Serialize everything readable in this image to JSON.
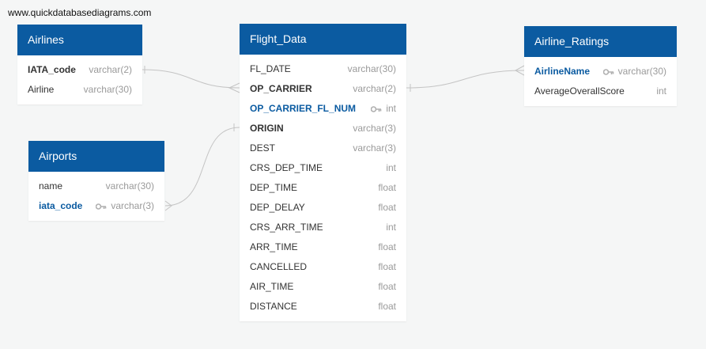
{
  "watermark": "www.quickdatabasediagrams.com",
  "tables": {
    "airlines": {
      "title": "Airlines",
      "fields": [
        {
          "name": "IATA_code",
          "type": "varchar(2)"
        },
        {
          "name": "Airline",
          "type": "varchar(30)"
        }
      ]
    },
    "airports": {
      "title": "Airports",
      "fields": [
        {
          "name": "name",
          "type": "varchar(30)"
        },
        {
          "name": "iata_code",
          "type": "varchar(3)"
        }
      ]
    },
    "flight_data": {
      "title": "Flight_Data",
      "fields": [
        {
          "name": "FL_DATE",
          "type": "varchar(30)"
        },
        {
          "name": "OP_CARRIER",
          "type": "varchar(2)"
        },
        {
          "name": "OP_CARRIER_FL_NUM",
          "type": "int"
        },
        {
          "name": "ORIGIN",
          "type": "varchar(3)"
        },
        {
          "name": "DEST",
          "type": "varchar(3)"
        },
        {
          "name": "CRS_DEP_TIME",
          "type": "int"
        },
        {
          "name": "DEP_TIME",
          "type": "float"
        },
        {
          "name": "DEP_DELAY",
          "type": "float"
        },
        {
          "name": "CRS_ARR_TIME",
          "type": "int"
        },
        {
          "name": "ARR_TIME",
          "type": "float"
        },
        {
          "name": "CANCELLED",
          "type": "float"
        },
        {
          "name": "AIR_TIME",
          "type": "float"
        },
        {
          "name": "DISTANCE",
          "type": "float"
        }
      ]
    },
    "airline_ratings": {
      "title": "Airline_Ratings",
      "fields": [
        {
          "name": "AirlineName",
          "type": "varchar(30)"
        },
        {
          "name": "AverageOverallScore",
          "type": "int"
        }
      ]
    }
  },
  "colors": {
    "header": "#0b5ba1",
    "primary_key_text": "#0b5ba1",
    "link_line": "#c4c4c4",
    "background": "#f5f6f6"
  },
  "icons": {
    "primary_key": "key-icon"
  }
}
